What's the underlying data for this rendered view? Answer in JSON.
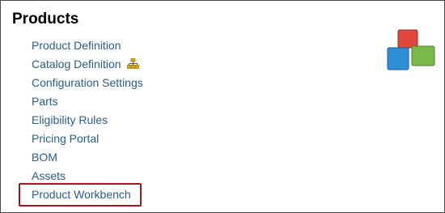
{
  "panel": {
    "title": "Products",
    "items": [
      {
        "label": "Product Definition"
      },
      {
        "label": "Catalog Definition",
        "icon": "hierarchy-icon"
      },
      {
        "label": "Configuration Settings"
      },
      {
        "label": "Parts"
      },
      {
        "label": "Eligibility Rules"
      },
      {
        "label": "Pricing Portal"
      },
      {
        "label": "BOM"
      },
      {
        "label": "Assets"
      },
      {
        "label": "Product Workbench",
        "highlighted": true
      }
    ],
    "logo_icon": "products-blocks-icon",
    "colors": {
      "link": "#2a5c8c",
      "highlight_border": "#a8151d",
      "block_red": "#e0473d",
      "block_blue": "#2f8fd6",
      "block_green": "#79b94a",
      "hierarchy_icon": "#d9a514"
    }
  }
}
